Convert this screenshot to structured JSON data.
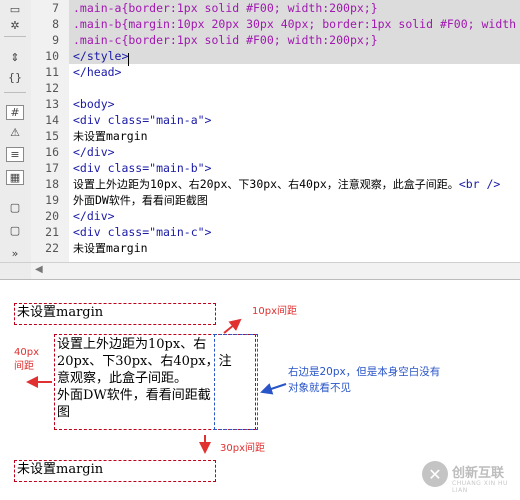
{
  "editor": {
    "line_numbers": [
      "7",
      "8",
      "9",
      "10",
      "11",
      "12",
      "13",
      "14",
      "15",
      "16",
      "17",
      "18",
      "19",
      "20",
      "21",
      "22"
    ],
    "lines": [
      [
        {
          "t": ".main-a{border:1px solid #F00; width:200px;}",
          "c": "pink"
        }
      ],
      [
        {
          "t": ".main-b{margin:10px 20px 30px 40px; border:1px solid #F00; width",
          "c": "pink"
        }
      ],
      [
        {
          "t": ".main-c{border:1px solid #F00; width:200px;}",
          "c": "pink"
        }
      ],
      [
        {
          "t": "</style>",
          "c": "blue"
        }
      ],
      [
        {
          "t": "</head>",
          "c": "blue"
        }
      ],
      [
        {
          "t": "",
          "c": "black"
        }
      ],
      [
        {
          "t": "<body>",
          "c": "blue"
        }
      ],
      [
        {
          "t": "<div class=\"main-a\">",
          "c": "blue"
        }
      ],
      [
        {
          "t": "未设置",
          "c": "black cjk"
        },
        {
          "t": "margin",
          "c": "black"
        }
      ],
      [
        {
          "t": "</div>",
          "c": "blue"
        }
      ],
      [
        {
          "t": "<div class=\"main-b\">",
          "c": "blue"
        }
      ],
      [
        {
          "t": "设置上外边距为",
          "c": "black cjk"
        },
        {
          "t": "10px",
          "c": "black"
        },
        {
          "t": "、右",
          "c": "black cjk"
        },
        {
          "t": "20px",
          "c": "black"
        },
        {
          "t": "、下",
          "c": "black cjk"
        },
        {
          "t": "30px",
          "c": "black"
        },
        {
          "t": "、右",
          "c": "black cjk"
        },
        {
          "t": "40px",
          "c": "black"
        },
        {
          "t": "，注意观察，此盒子间距。",
          "c": "black cjk"
        },
        {
          "t": "<br />",
          "c": "blue"
        }
      ],
      [
        {
          "t": "外面",
          "c": "black cjk"
        },
        {
          "t": "DW",
          "c": "black"
        },
        {
          "t": "软件，看看间距截图",
          "c": "black cjk"
        }
      ],
      [
        {
          "t": "</div>",
          "c": "blue"
        }
      ],
      [
        {
          "t": "<div class=\"main-c\">",
          "c": "blue"
        }
      ],
      [
        {
          "t": "未设置",
          "c": "black cjk"
        },
        {
          "t": "margin",
          "c": "black"
        }
      ]
    ]
  },
  "toolbar": {
    "icons": [
      "panel-icon",
      "expand-icon",
      "collapse-icon",
      "select-parent-icon",
      "balance-braces-icon",
      "line-numbers-icon",
      "highlight-invalid-icon",
      "word-wrap-icon",
      "syntax-coloring-icon",
      "comment-icon",
      "uncomment-icon",
      "more-icon"
    ]
  },
  "preview": {
    "box_a": "未设置margin",
    "box_b_lines": [
      "设置上外边距为10px、右",
      "20px、下30px、右40px，注",
      "意观察，此盒子间距。",
      "外面DW软件，看看间距截",
      "图"
    ],
    "box_c": "未设置margin",
    "note_top": "10px间距",
    "note_left": [
      "40px",
      "间距"
    ],
    "note_right": [
      "右边是20px，但是本身空白没有",
      "对象就看不见"
    ],
    "note_bottom": "30px间距",
    "colors": {
      "annotation_red": "#e03030",
      "annotation_blue": "#2a55c8",
      "box_border": "#c0001a"
    }
  },
  "watermark": {
    "icon": "chuangxin-logo-icon",
    "text": "创新互联",
    "sub": "CHUANG XIN HU LIAN"
  }
}
